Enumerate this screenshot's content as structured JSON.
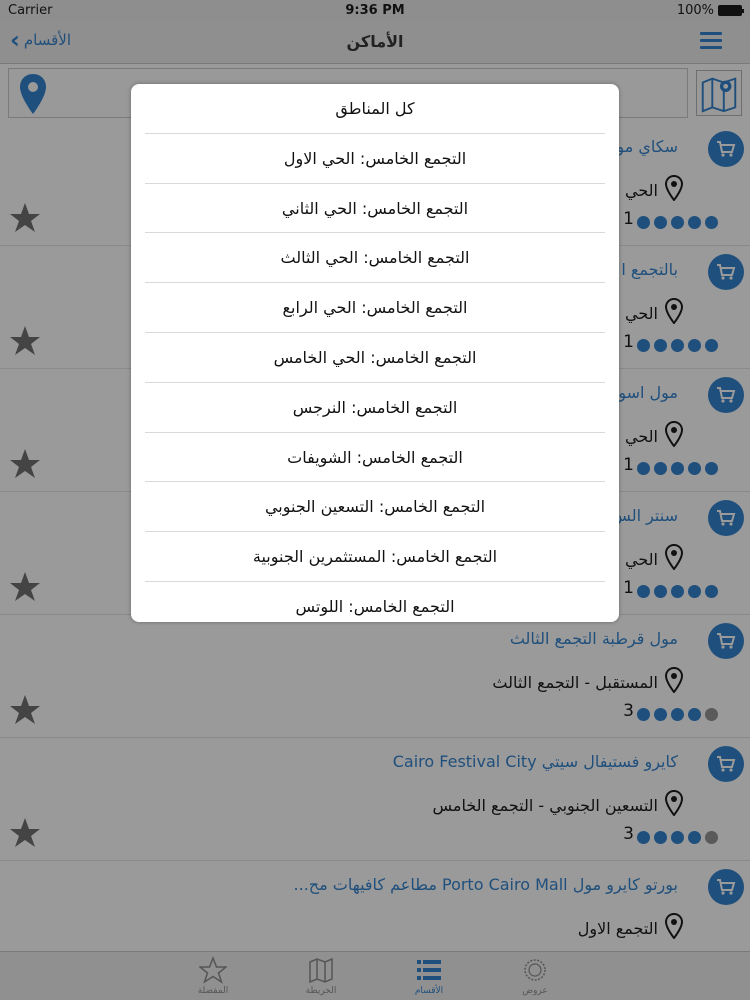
{
  "status": {
    "carrier": "Carrier",
    "time": "9:36 PM",
    "battery": "100%"
  },
  "nav": {
    "back_label": "الأقسام",
    "title": "الأماكن"
  },
  "list": [
    {
      "name": "سكاي مو",
      "address": "الحي",
      "rating": "1",
      "dots_filled": 5
    },
    {
      "name": "بالتجمع ا",
      "address": "الحي",
      "rating": "1",
      "dots_filled": 5
    },
    {
      "name": "مول اسوا",
      "address": "الحي",
      "rating": "1",
      "dots_filled": 5
    },
    {
      "name": "سنتر الس",
      "address": "الحي",
      "rating": "1",
      "dots_filled": 5
    },
    {
      "name": "مول قرطبة التجمع الثالث",
      "address": "المستقبل - التجمع الثالث",
      "rating": "3",
      "dots_filled": 4
    },
    {
      "name": "كايرو فستيفال سيتي Cairo Festival City",
      "address": "التسعين الجنوبي - التجمع الخامس",
      "rating": "3",
      "dots_filled": 4
    },
    {
      "name": "بورتو كايرو مول Porto Cairo Mall مطاعم كافيهات مح...",
      "address": "التجمع الاول",
      "rating": "",
      "dots_filled": 0
    }
  ],
  "modal": {
    "options": [
      "كل المناطق",
      "التجمع الخامس: الحي الاول",
      "التجمع الخامس: الحي الثاني",
      "التجمع الخامس: الحي الثالث",
      "التجمع الخامس: الحي الرابع",
      "التجمع الخامس: الحي الخامس",
      "التجمع الخامس: النرجس",
      "التجمع الخامس: الشويفات",
      "التجمع الخامس: التسعين الجنوبي",
      "التجمع الخامس: المستثمرين الجنوبية",
      "التجمع الخامس: اللوتس"
    ]
  },
  "tabs": [
    {
      "label": "المفضلة",
      "icon": "star-icon"
    },
    {
      "label": "الخريطة",
      "icon": "map-icon"
    },
    {
      "label": "الأقسام",
      "icon": "list-icon"
    },
    {
      "label": "عروض",
      "icon": "gear-badge-icon"
    }
  ],
  "colors": {
    "accent": "#1f4f7c"
  }
}
